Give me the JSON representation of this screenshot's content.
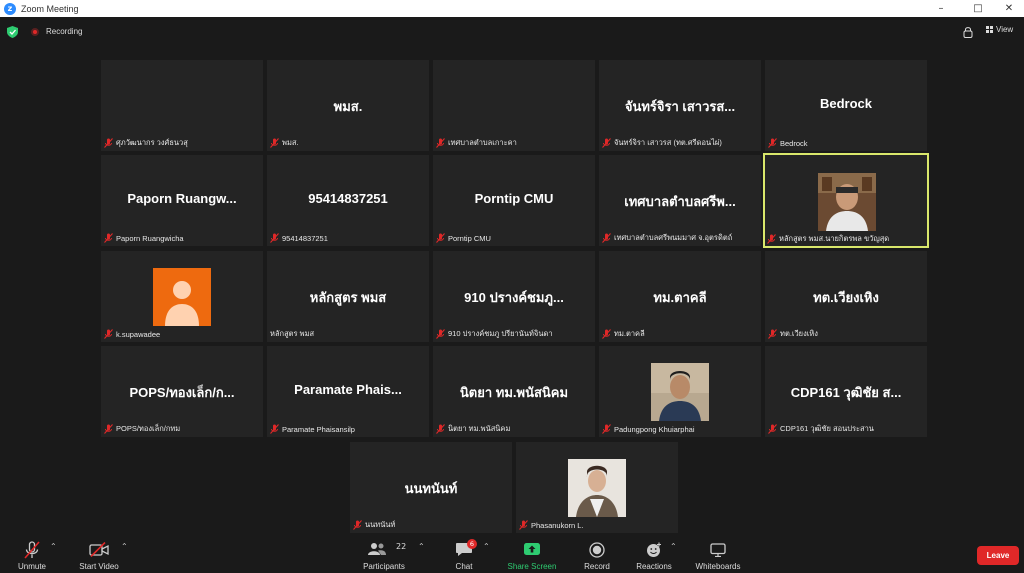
{
  "window": {
    "title": "Zoom Meeting"
  },
  "topbar": {
    "recording_label": "Recording",
    "view_label": "View"
  },
  "tiles": [
    {
      "display": "",
      "label": "ศุภวัฒนากร วงศ์ธนวสุ"
    },
    {
      "display": "พมส.",
      "label": "พมส."
    },
    {
      "display": "",
      "label": "เทศบาลตำบลเกาะคา"
    },
    {
      "display": "จันทร์จิรา เสาวรส...",
      "label": "จันทร์จิรา เสาวรส (ทต.ศรีดอนไผ่)"
    },
    {
      "display": "Bedrock",
      "label": "Bedrock"
    },
    {
      "display": "Paporn Ruangw...",
      "label": "Paporn Ruangwicha"
    },
    {
      "display": "95414837251",
      "label": "95414837251"
    },
    {
      "display": "Porntip CMU",
      "label": "Porntip CMU"
    },
    {
      "display": "เทศบาลตำบลศรีพ...",
      "label": "เทศบาลตำบลศรีพนมมาศ จ.อุตรดิตถ์"
    },
    {
      "display": "",
      "label": "หลักสูตร พมส.นายกิตรพล ขวัญสุด"
    },
    {
      "display": "",
      "label": "k.supawadee"
    },
    {
      "display": "หลักสูตร พมส",
      "label": "หลักสูตร พมส"
    },
    {
      "display": "910 ปรางค์ชมภู...",
      "label": "910 ปรางค์ชมภู ปรียานันท์จินดา"
    },
    {
      "display": "ทม.ตาคลี",
      "label": "ทม.ตาคลี"
    },
    {
      "display": "ทต.เวียงเหิง",
      "label": "ทต.เวียงเหิง"
    },
    {
      "display": "POPS/ทองเล็ก/ก...",
      "label": "POPS/ทองเล็ก/กทม"
    },
    {
      "display": "Paramate Phais...",
      "label": "Paramate Phaisansilp"
    },
    {
      "display": "นิตยา ทม.พนัสนิคม",
      "label": "นิตยา ทม.พนัสนิคม"
    },
    {
      "display": "",
      "label": "Padungpong Khuiarphai"
    },
    {
      "display": "CDP161 วุฒิชัย ส...",
      "label": "CDP161 วุฒิชัย สอนประสาน"
    },
    {
      "display": "นนทนันท์",
      "label": "นนทนันท์"
    },
    {
      "display": "",
      "label": "Phasanukorn L."
    }
  ],
  "toolbar": {
    "unmute": "Unmute",
    "start_video": "Start Video",
    "participants": "Participants",
    "participants_count": "22",
    "chat": "Chat",
    "chat_badge": "6",
    "share_screen": "Share Screen",
    "record": "Record",
    "reactions": "Reactions",
    "whiteboards": "Whiteboards",
    "leave": "Leave"
  },
  "colors": {
    "accent_green": "#2ecc71",
    "leave_red": "#e02828",
    "active_speaker": "#d9e76b",
    "avatar_orange": "#ee6a0f"
  }
}
